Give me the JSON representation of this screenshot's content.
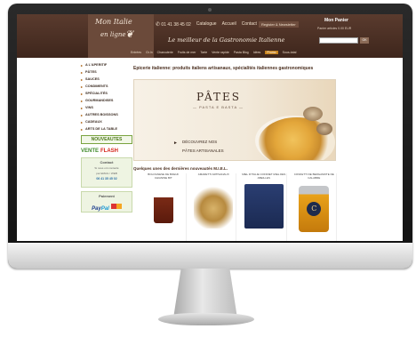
{
  "header": {
    "logo_line1": "Mon Italie",
    "logo_line2": "en ligne",
    "phone": "01 41 38 45 02",
    "nav": [
      "Catalogue",
      "Accueil",
      "Contact"
    ],
    "newsletter": "Register & Newsletter",
    "cart_title": "Mon Panier",
    "cart_sub": "Panier articles 0.00 EUR",
    "tagline": "Le meilleur de la Gastronomie Italienne",
    "search_button": "OK"
  },
  "category_nav": [
    "Entrées",
    "Gr.In",
    "Charcuterie",
    "Fruits de mer",
    "Tarte",
    "Vente rapide",
    "Pasta Blog",
    "Idées",
    "Promo",
    "Sous-total"
  ],
  "category_nav_active_index": 8,
  "sidebar": {
    "items": [
      "A L'APERITIF",
      "PÂTES",
      "SAUCES",
      "CONDIMENTS",
      "SPÉCIALITÉS",
      "GOURMANDISES",
      "VINS",
      "AUTRES BOISSONS",
      "CADEAUX",
      "ARTS DE LA TABLE"
    ],
    "new_button": "NOUVEAUTES",
    "flash_green": "VENTE",
    "flash_red": "FLASH",
    "contact_title": "Contact",
    "contact_line1": "Si nous ont contacté",
    "contact_line2": "par EMAIL / WEB",
    "contact_phone": "06 41 35 45 02",
    "payment_title": "Paiement",
    "paypal_a": "Pay",
    "paypal_b": "Pal"
  },
  "main": {
    "title": "Epicerie italienne: produits italiens artisanaux, spécialités italiennes gastronomiques",
    "banner": {
      "title": "PÂTES",
      "subtitle": "— PASTA E BASTA —",
      "link_line1": "DÉCOUVREZ NOS",
      "link_line2": "PÂTES ARTISANALES"
    },
    "recent_title": "Quelques unes des dernières nouveautés M.I.E.L.",
    "products": [
      {
        "name": "BOLOGNESE DE BOEUF CHIANINE BIT"
      },
      {
        "name": "AMARETTI ARTISANAUX"
      },
      {
        "name": "MIEL D'ITALIE COFFRET MIEL DES ABEILLES"
      },
      {
        "name": "CONFETTI DE BERGAMOTE DE CALABRE"
      }
    ]
  },
  "colors": {
    "header_brown": "#4a2e22",
    "accent_orange": "#c8831d",
    "green": "#3f8a2a",
    "red": "#d4261c"
  }
}
